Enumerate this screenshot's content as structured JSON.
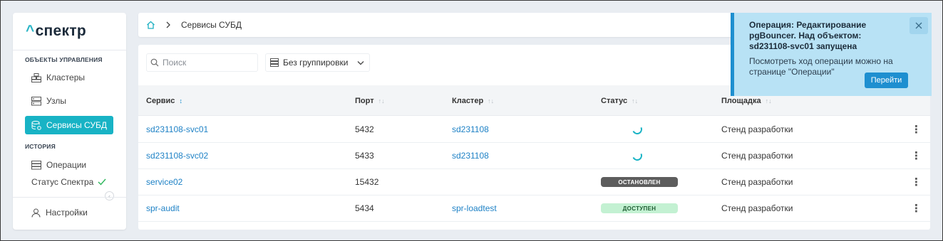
{
  "sidebar": {
    "logo": "спектр",
    "sections": [
      {
        "title": "ОБЪЕКТЫ УПРАВЛЕНИЯ"
      },
      {
        "title": "ИСТОРИЯ"
      }
    ],
    "items": [
      {
        "label": "Кластеры",
        "icon": "cluster-icon"
      },
      {
        "label": "Узлы",
        "icon": "server-icon"
      },
      {
        "label": "Сервисы СУБД",
        "icon": "database-icon",
        "active": true
      },
      {
        "label": "Операции",
        "icon": "operations-icon"
      }
    ],
    "status_label": "Статус Спектра",
    "settings_label": "Настройки"
  },
  "header": {
    "breadcrumb": "Сервисы СУБД"
  },
  "toolbar": {
    "search_placeholder": "Поиск",
    "grouping_value": "Без группировки"
  },
  "table": {
    "columns": [
      "Сервис",
      "Порт",
      "Кластер",
      "Статус",
      "Площадка"
    ],
    "rows": [
      {
        "service": "sd231108-svc01",
        "port": "5432",
        "cluster": "sd231108",
        "status": "spinner",
        "site": "Стенд разработки"
      },
      {
        "service": "sd231108-svc02",
        "port": "5433",
        "cluster": "sd231108",
        "status": "spinner",
        "site": "Стенд разработки"
      },
      {
        "service": "service02",
        "port": "15432",
        "cluster": "",
        "status": "ОСТАНОВЛЕН",
        "site": "Стенд разработки"
      },
      {
        "service": "spr-audit",
        "port": "5434",
        "cluster": "spr-loadtest",
        "status": "ДОСТУПЕН",
        "site": "Стенд разработки"
      }
    ]
  },
  "toast": {
    "title": "Операция: Редактирование pgBouncer. Над объектом: sd231108-svc01 запущена",
    "text": "Посмотреть ход операции можно на странице \"Операции\"",
    "button": "Перейти"
  },
  "colors": {
    "accent": "#18b3c5",
    "link": "#1f82c6",
    "toast_bg": "#b8e2f5",
    "toast_button": "#1e8fd0"
  }
}
